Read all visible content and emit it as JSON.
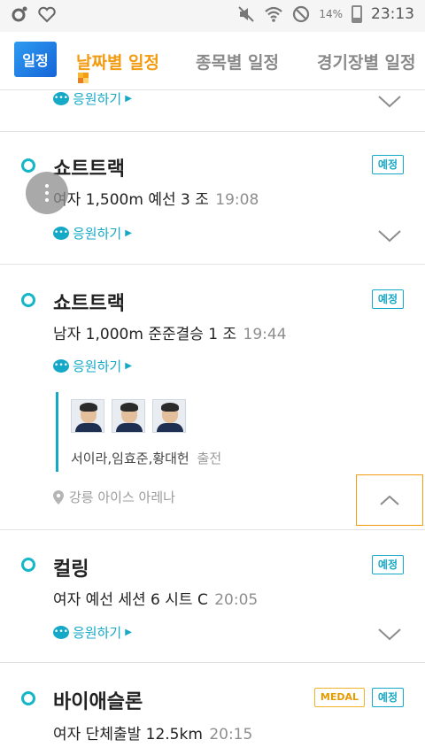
{
  "status_bar": {
    "battery_text": "14%",
    "time": "23:13",
    "icons": [
      "circle-app-icon",
      "heart-outline-icon",
      "mute-icon",
      "wifi-icon",
      "block-icon",
      "battery-icon"
    ]
  },
  "header": {
    "app_badge": "일정",
    "tabs": [
      {
        "label": "날짜별 일정",
        "active": true
      },
      {
        "label": "종목별 일정",
        "active": false
      },
      {
        "label": "경기장별 일정",
        "active": false
      }
    ]
  },
  "cheer_label": "응원하기",
  "events": [
    {
      "sport": "쇼트트랙",
      "detail": "여자 1,500m 예선 3 조",
      "time": "19:08",
      "status": "예정"
    },
    {
      "sport": "쇼트트랙",
      "detail": "남자 1,000m 준준결승 1 조",
      "time": "19:44",
      "status": "예정",
      "athletes": "서이라,임효준,황대헌",
      "athletes_status": "출전",
      "venue": "강릉 아이스 아레나"
    },
    {
      "sport": "컬링",
      "detail": "여자 예선 세션 6 시트 C",
      "time": "20:05",
      "status": "예정"
    },
    {
      "sport": "바이애슬론",
      "detail": "여자 단체출발 12.5km",
      "time": "20:15",
      "status": "예정",
      "medal": "MEDAL"
    }
  ],
  "colors": {
    "accent_teal": "#15a9c7",
    "accent_orange": "#f39c12",
    "app_blue": "#1e88e5"
  }
}
